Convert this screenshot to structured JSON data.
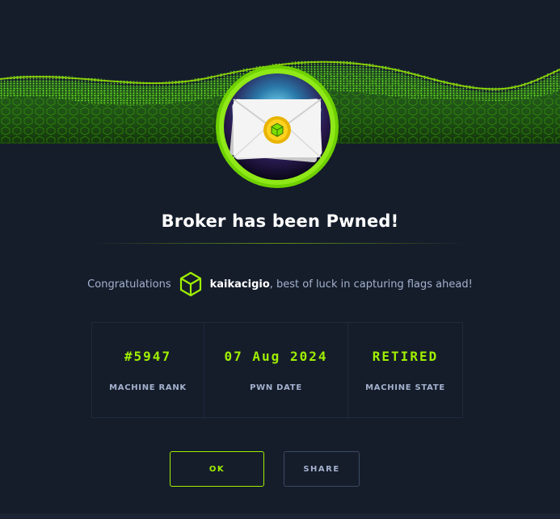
{
  "modal": {
    "title": "Broker has been Pwned!",
    "congrats_prefix": "Congratulations",
    "username": "kaikacigio",
    "congrats_suffix": ", best of luck in capturing flags ahead!"
  },
  "stats": [
    {
      "value": "#5947",
      "label": "MACHINE RANK"
    },
    {
      "value": "07 Aug 2024",
      "label": "PWN DATE"
    },
    {
      "value": "RETIRED",
      "label": "MACHINE STATE"
    }
  ],
  "buttons": {
    "ok_label": "OK",
    "share_label": "SHARE"
  },
  "colors": {
    "background": "#151d2b",
    "accent": "#9fef00",
    "muted_text": "#a4b1cd",
    "border": "#1f2a3b"
  },
  "icons": {
    "badge": "machine-badge-envelope-icon",
    "user": "user-cube-icon"
  }
}
